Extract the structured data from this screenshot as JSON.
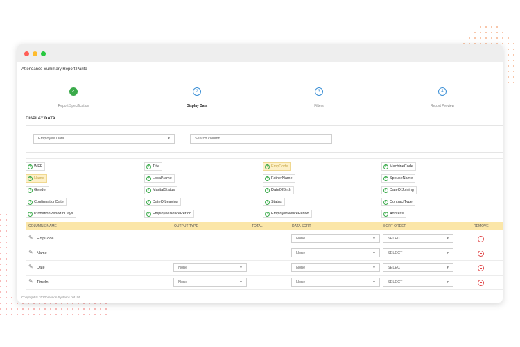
{
  "window": {
    "traffic_lights": [
      "#ff5f57",
      "#febc2e",
      "#28c840"
    ],
    "report_title": "Attendance Summary Report Parita"
  },
  "stepper": [
    {
      "number": "",
      "label": "Report Specification",
      "state": "done"
    },
    {
      "number": "2",
      "label": "Display Data",
      "state": "active"
    },
    {
      "number": "3",
      "label": "Filters",
      "state": "pending"
    },
    {
      "number": "4",
      "label": "Report Preview",
      "state": "pending"
    }
  ],
  "section_title": "DISPLAY DATA",
  "filters": {
    "category_select": "Employee Data",
    "search_placeholder": "Search column"
  },
  "columns": [
    [
      "WEF",
      "Title",
      "EmpCode",
      "MachineCode"
    ],
    [
      "Name",
      "LocalName",
      "FatherName",
      "SpouseName"
    ],
    [
      "Gender",
      "MaritalStatus",
      "DateOfBirth",
      "DateOfJoining"
    ],
    [
      "ConfirmationDate",
      "DateOfLeaving",
      "Status",
      "ContractType"
    ],
    [
      "ProbationPeriodInDays",
      "EmployeeNoticePeriod",
      "EmployerNoticePeriod",
      "Address"
    ]
  ],
  "selected_columns": [
    "EmpCode",
    "Name"
  ],
  "table": {
    "headers": [
      "COLUMNS NAME",
      "OUTPUT TYPE",
      "TOTAL",
      "DATA SORT",
      "SORT ORDER",
      "REMOVE"
    ],
    "rows": [
      {
        "name": "EmpCode",
        "output_type": "",
        "data_sort": "None",
        "sort_order": "SELECT"
      },
      {
        "name": "Name",
        "output_type": "",
        "data_sort": "None",
        "sort_order": "SELECT"
      },
      {
        "name": "Date",
        "output_type": "None",
        "data_sort": "None",
        "sort_order": "SELECT"
      },
      {
        "name": "TimeIn",
        "output_type": "None",
        "data_sort": "None",
        "sort_order": "SELECT"
      }
    ]
  },
  "footer": "Copyright © 2022 Version Systems pvt. ltd.",
  "colors": {
    "accent": "#3a8fd6",
    "success": "#3aaa4a",
    "header_bg": "#fbe6a8",
    "remove": "#e0484a",
    "dots": "#f2a07a"
  }
}
